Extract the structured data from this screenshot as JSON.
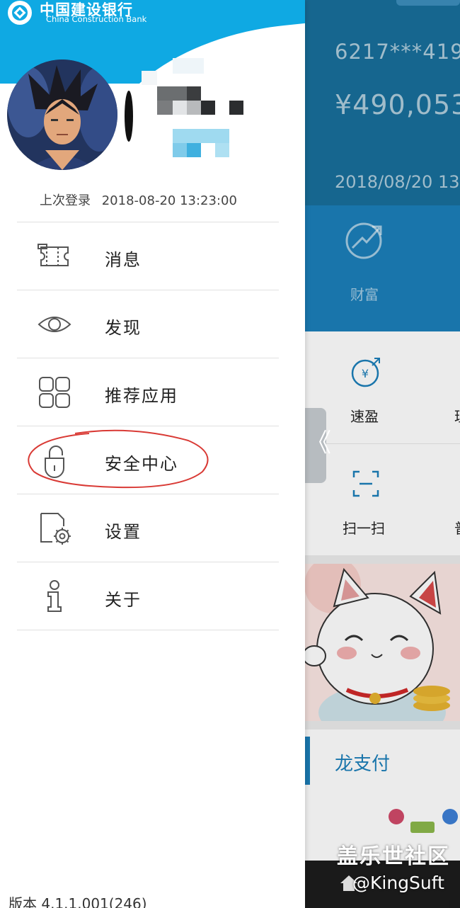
{
  "bank": {
    "name_cn": "中国建设银行",
    "name_en": "China Construction Bank"
  },
  "user": {
    "last_login_label": "上次登录",
    "last_login_time": "2018-08-20 13:23:00"
  },
  "menu": [
    {
      "label": "消息",
      "icon": "ticket-icon"
    },
    {
      "label": "发现",
      "icon": "eye-icon"
    },
    {
      "label": "推荐应用",
      "icon": "apps-grid-icon"
    },
    {
      "label": "安全中心",
      "icon": "unlock-icon",
      "annotated": true
    },
    {
      "label": "设置",
      "icon": "settings-document-icon"
    },
    {
      "label": "关于",
      "icon": "info-icon"
    }
  ],
  "version": "版本 4.1.1.001(246)",
  "background_app": {
    "card_number": "6217***419",
    "balance": "¥490,053",
    "date": "2018/08/20 13",
    "wealth_label": "财富",
    "shortcuts": [
      {
        "label": "速盈",
        "icon": "yuan-exchange-icon"
      },
      {
        "label": "扫一扫",
        "icon": "scan-icon"
      }
    ],
    "pay_label": "龙支付",
    "drawer_handle_glyph": "《"
  },
  "watermark": {
    "site": "盖乐世社区",
    "handle": "@KingSuft"
  },
  "colors": {
    "brand_blue": "#0fa9e3",
    "app_blue": "#1c7fba",
    "annotation_red": "#d93a35"
  }
}
